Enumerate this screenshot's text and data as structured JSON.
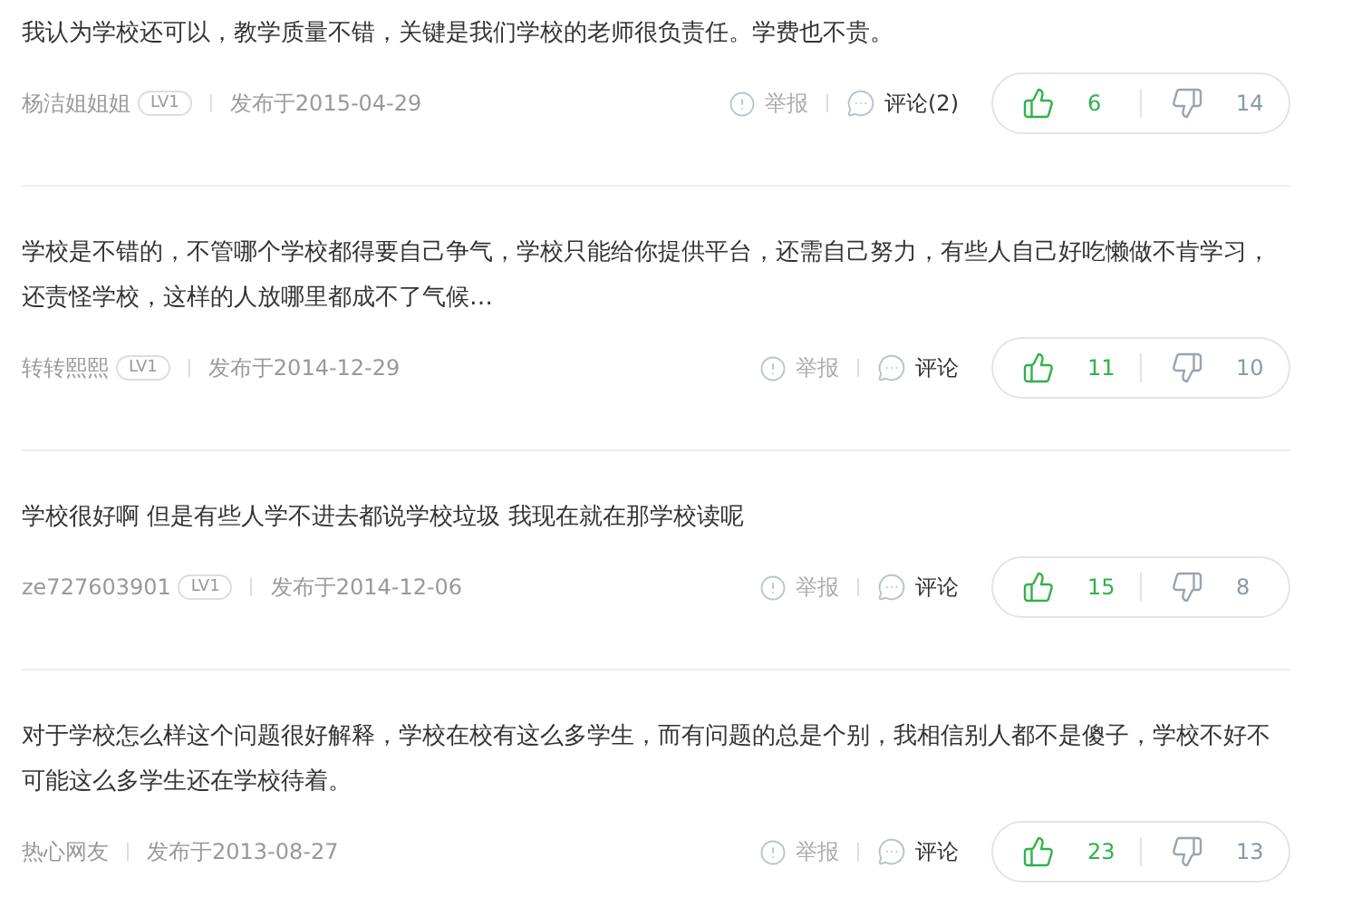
{
  "reviews": [
    {
      "text": "我认为学校还可以，教学质量不错，关键是我们学校的老师很负责任。学费也不贵。",
      "author": "杨洁姐姐姐",
      "level": "LV1",
      "date": "发布于2015-04-29",
      "report": "举报",
      "comment": "评论(2)",
      "likes": "6",
      "dislikes": "14"
    },
    {
      "text": "学校是不错的，不管哪个学校都得要自己争气，学校只能给你提供平台，还需自己努力，有些人自己好吃懒做不肯学习，还责怪学校，这样的人放哪里都成不了气候…",
      "author": "转转熙熙",
      "level": "LV1",
      "date": "发布于2014-12-29",
      "report": "举报",
      "comment": "评论",
      "likes": "11",
      "dislikes": "10"
    },
    {
      "text": "学校很好啊 但是有些人学不进去都说学校垃圾 我现在就在那学校读呢",
      "author": "ze727603901",
      "level": "LV1",
      "date": "发布于2014-12-06",
      "report": "举报",
      "comment": "评论",
      "likes": "15",
      "dislikes": "8"
    },
    {
      "text": "对于学校怎么样这个问题很好解释，学校在校有这么多学生，而有问题的总是个别，我相信别人都不是傻子，学校不好不可能这么多学生还在学校待着。",
      "author": "热心网友",
      "date": "发布于2013-08-27",
      "report": "举报",
      "comment": "评论",
      "likes": "23",
      "dislikes": "13"
    }
  ]
}
